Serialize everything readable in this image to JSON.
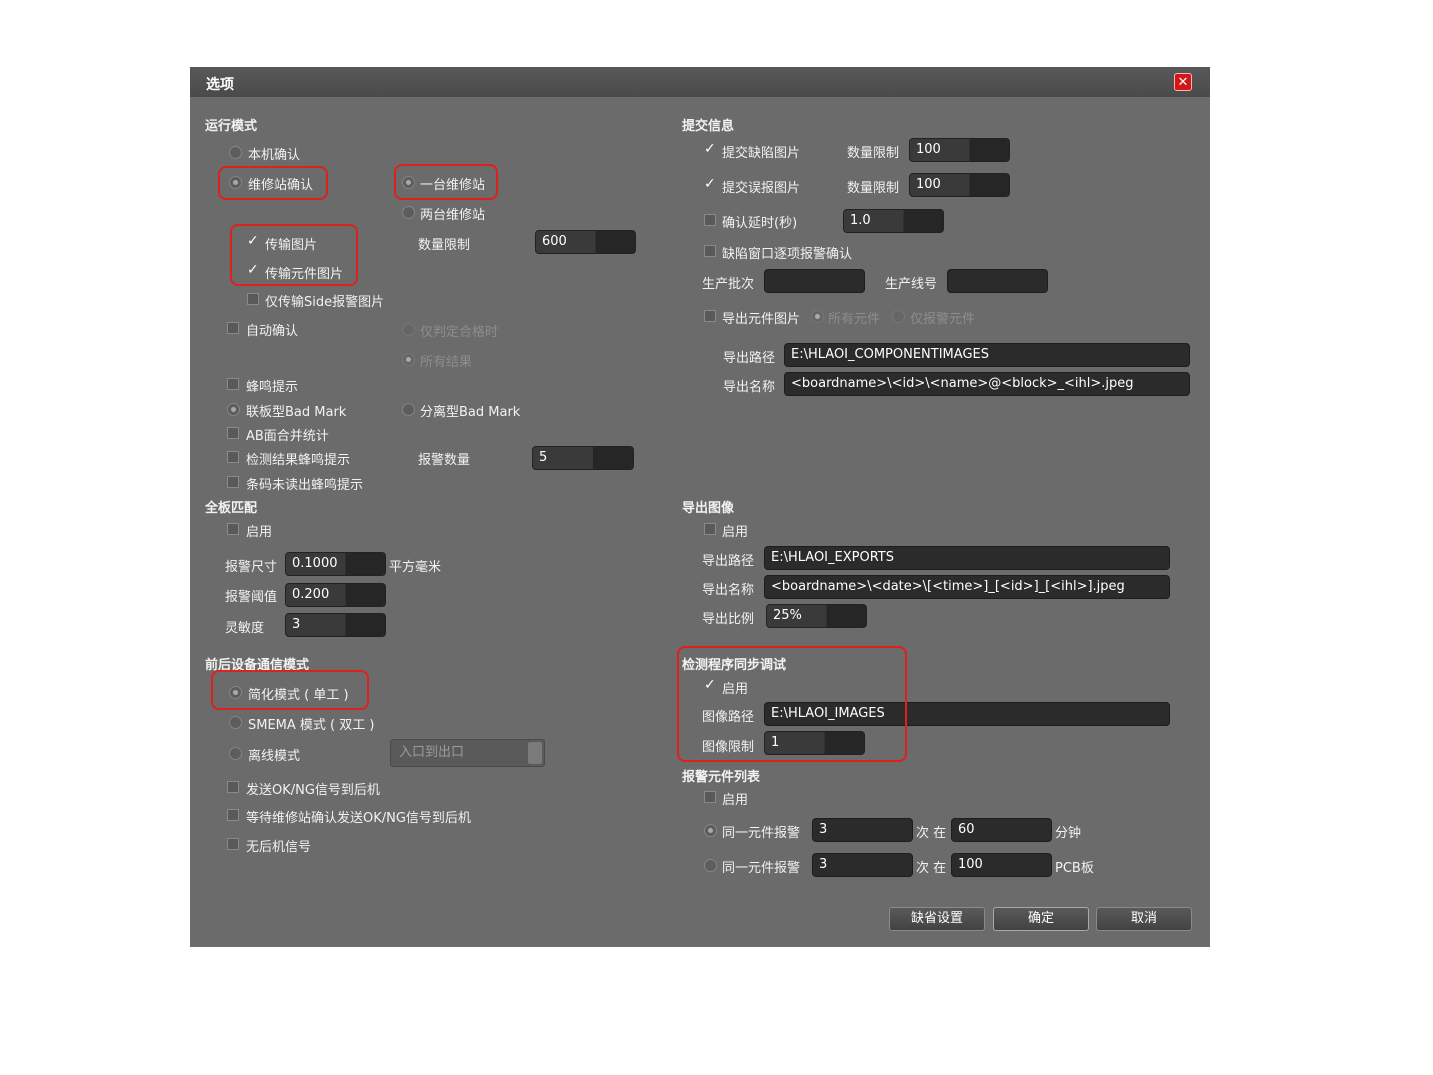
{
  "dialog": {
    "title": "选项",
    "close_icon": "close-icon"
  },
  "left": {
    "run_mode": {
      "heading": "运行模式",
      "local_confirm": "本机确认",
      "station_confirm": "维修站确认",
      "one_station": "一台维修站",
      "two_stations": "两台维修站",
      "transfer_image": "传输图片",
      "transfer_component_image": "传输元件图片",
      "transfer_side_only": "仅传输Side报警图片",
      "qty_limit_label": "数量限制",
      "qty_limit_value": "600",
      "auto_confirm": "自动确认",
      "only_pass": "仅判定合格时",
      "all_results": "所有结果",
      "buzzer": "蜂鸣提示",
      "joint_badmark": "联板型Bad Mark",
      "split_badmark": "分离型Bad Mark",
      "ab_merge": "AB面合并统计",
      "result_buzzer": "检测结果蜂鸣提示",
      "alarm_count_label": "报警数量",
      "alarm_count_value": "5",
      "barcode_buzzer": "条码未读出蜂鸣提示"
    },
    "full_board": {
      "heading": "全板匹配",
      "enable": "启用",
      "alarm_size_label": "报警尺寸",
      "alarm_size_value": "0.1000",
      "unit": "平方毫米",
      "alarm_threshold_label": "报警阈值",
      "alarm_threshold_value": "0.200",
      "sensitivity_label": "灵敏度",
      "sensitivity_value": "3"
    },
    "comm": {
      "heading": "前后设备通信模式",
      "simple_mode": "简化模式 ( 单工 )",
      "smema_mode": "SMEMA 模式 ( 双工 )",
      "offline_mode": "离线模式",
      "offline_select": "入口到出口",
      "send_okng": "发送OK/NG信号到后机",
      "wait_station": "等待维修站确认发送OK/NG信号到后机",
      "no_rear_signal": "无后机信号"
    }
  },
  "right": {
    "submit": {
      "heading": "提交信息",
      "submit_defect": "提交缺陷图片",
      "defect_limit_label": "数量限制",
      "defect_limit_value": "100",
      "submit_false": "提交误报图片",
      "false_limit_label": "数量限制",
      "false_limit_value": "100",
      "confirm_delay": "确认延时(秒)",
      "confirm_delay_value": "1.0",
      "defect_window": "缺陷窗口逐项报警确认",
      "batch_label": "生产批次",
      "batch_value": "",
      "line_label": "生产线号",
      "line_value": "",
      "export_comp": "导出元件图片",
      "all_components": "所有元件",
      "alarm_components_only": "仅报警元件",
      "export_path_label": "导出路径",
      "export_path_value": "E:\\HLAOI_COMPONENTIMAGES",
      "export_name_label": "导出名称",
      "export_name_value": "<boardname>\\<id>\\<name>@<block>_<ihl>.jpeg"
    },
    "export_image": {
      "heading": "导出图像",
      "enable": "启用",
      "path_label": "导出路径",
      "path_value": "E:\\HLAOI_EXPORTS",
      "name_label": "导出名称",
      "name_value": "<boardname>\\<date>\\[<time>]_[<id>]_[<ihl>].jpeg",
      "ratio_label": "导出比例",
      "ratio_value": "25%"
    },
    "sync_debug": {
      "heading": "检测程序同步调试",
      "enable": "启用",
      "path_label": "图像路径",
      "path_value": "E:\\HLAOI_IMAGES",
      "limit_label": "图像限制",
      "limit_value": "1"
    },
    "alarm_list": {
      "heading": "报警元件列表",
      "enable": "启用",
      "row1_label": "同一元件报警",
      "row1_count": "3",
      "row1_mid": "次 在",
      "row1_value": "60",
      "row1_unit": "分钟",
      "row2_label": "同一元件报警",
      "row2_count": "3",
      "row2_mid": "次 在",
      "row2_value": "100",
      "row2_unit": "PCB板"
    }
  },
  "buttons": {
    "defaults": "缺省设置",
    "ok": "确定",
    "cancel": "取消"
  },
  "colors": {
    "background": "#6b6b6b",
    "titlebar": "#4e4e4e",
    "highlight": "#e0201c",
    "close": "#d01818"
  }
}
